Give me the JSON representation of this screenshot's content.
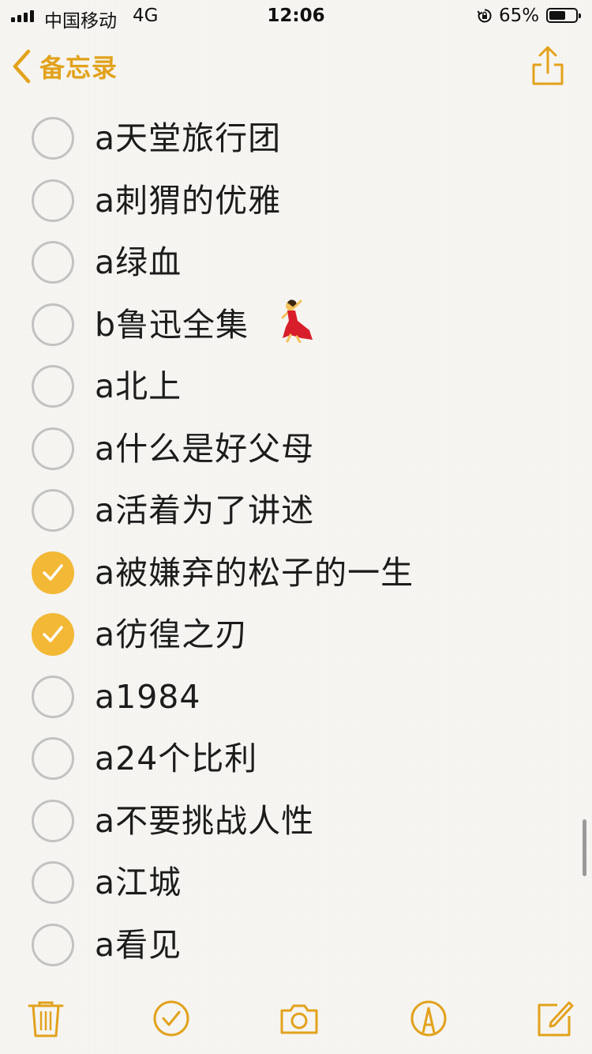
{
  "status_bar": {
    "carrier": "中国移动",
    "network": "4G",
    "time": "12:06",
    "battery_percent": "65%",
    "battery_level": 0.65
  },
  "nav": {
    "back_label": "备忘录",
    "back_icon": "chevron-left-icon",
    "share_icon": "share-icon"
  },
  "checklist": {
    "items": [
      {
        "text": "a天堂旅行团",
        "checked": false
      },
      {
        "text": "a刺猬的优雅",
        "checked": false
      },
      {
        "text": "a绿血",
        "checked": false
      },
      {
        "text": " b鲁迅全集",
        "checked": false,
        "emoji": "dancing-woman-emoji"
      },
      {
        "text": "a北上",
        "checked": false
      },
      {
        "text": "a什么是好父母",
        "checked": false
      },
      {
        "text": "a活着为了讲述",
        "checked": false
      },
      {
        "text": "a被嫌弃的松子的一生",
        "checked": true
      },
      {
        "text": "a彷徨之刃",
        "checked": true
      },
      {
        "text": "a1984",
        "checked": false
      },
      {
        "text": "a24个比利",
        "checked": false
      },
      {
        "text": "a不要挑战人性",
        "checked": false
      },
      {
        "text": "a江城",
        "checked": false
      },
      {
        "text": "a看见",
        "checked": false
      }
    ]
  },
  "toolbar": {
    "items": [
      "trash-icon",
      "checklist-icon",
      "camera-icon",
      "markup-icon",
      "compose-icon"
    ]
  },
  "colors": {
    "accent": "#e2a21c",
    "checked_fill": "#f2b836",
    "unchecked_border": "#c2c2c2",
    "background": "#f7f6f2"
  }
}
